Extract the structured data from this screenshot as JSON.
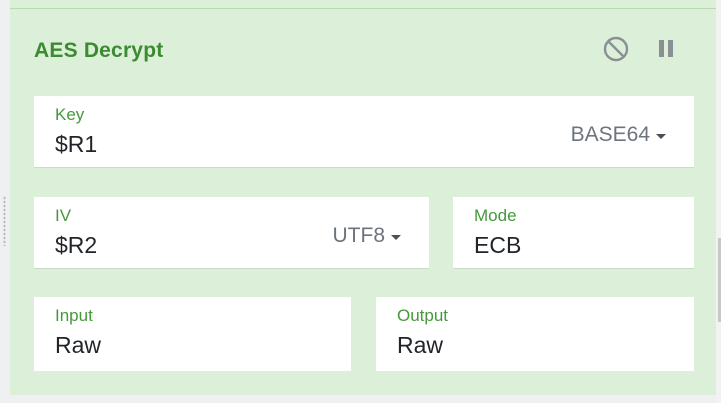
{
  "operation": {
    "title": "AES Decrypt",
    "disable_icon": "disable-icon",
    "pause_icon": "pause-icon"
  },
  "fields": {
    "key": {
      "label": "Key",
      "value": "$R1",
      "encoding": "BASE64"
    },
    "iv": {
      "label": "IV",
      "value": "$R2",
      "encoding": "UTF8"
    },
    "mode": {
      "label": "Mode",
      "value": "ECB"
    },
    "input": {
      "label": "Input",
      "value": "Raw"
    },
    "output": {
      "label": "Output",
      "value": "Raw"
    }
  },
  "colors": {
    "card_background": "#dcf0d9",
    "title_green": "#3b8b31",
    "label_green": "#45993b",
    "field_background": "#ffffff"
  }
}
